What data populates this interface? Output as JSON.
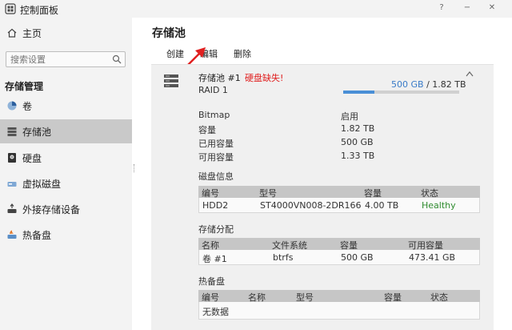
{
  "window": {
    "title": "控制面板",
    "help": "?",
    "minimize": "−",
    "close": "✕",
    "accent": "#3a7bc8"
  },
  "sidebar": {
    "home": "主页",
    "search_placeholder": "搜索设置",
    "section": "存储管理",
    "items": [
      {
        "label": "卷",
        "icon": "pie-volume-icon"
      },
      {
        "label": "存储池",
        "icon": "storage-pool-icon"
      },
      {
        "label": "硬盘",
        "icon": "hard-disk-icon"
      },
      {
        "label": "虚拟磁盘",
        "icon": "virtual-disk-icon"
      },
      {
        "label": "外接存储设备",
        "icon": "external-storage-icon"
      },
      {
        "label": "热备盘",
        "icon": "hot-spare-icon"
      }
    ],
    "active": "存储池"
  },
  "main": {
    "title": "存储池",
    "toolbar": {
      "create": "创建",
      "edit": "编辑",
      "delete": "删除"
    },
    "pool": {
      "name": "存储池 #1",
      "warning": "硬盘缺失!",
      "raid": "RAID 1",
      "used": "500 GB",
      "total": "/ 1.82 TB",
      "usage_fraction": 0.27,
      "props": [
        {
          "label": "Bitmap",
          "value": "启用"
        },
        {
          "label": "容量",
          "value": "1.82 TB"
        },
        {
          "label": "已用容量",
          "value": "500 GB"
        },
        {
          "label": "可用容量",
          "value": "1.33 TB"
        }
      ],
      "disks": {
        "title": "磁盘信息",
        "headers": [
          "编号",
          "型号",
          "容量",
          "状态"
        ],
        "row": [
          "HDD2",
          "ST4000VN008-2DR166",
          "4.00 TB",
          "Healthy"
        ],
        "healthy_color": "#2e8b2e"
      },
      "allocation": {
        "title": "存储分配",
        "headers": [
          "名称",
          "文件系统",
          "容量",
          "可用容量"
        ],
        "row": [
          "卷 #1",
          "btrfs",
          "500 GB",
          "473.41 GB"
        ]
      },
      "hot_spare": {
        "title": "热备盘",
        "headers": [
          "编号",
          "名称",
          "型号",
          "容量",
          "状态"
        ],
        "empty": "无数据"
      }
    }
  }
}
